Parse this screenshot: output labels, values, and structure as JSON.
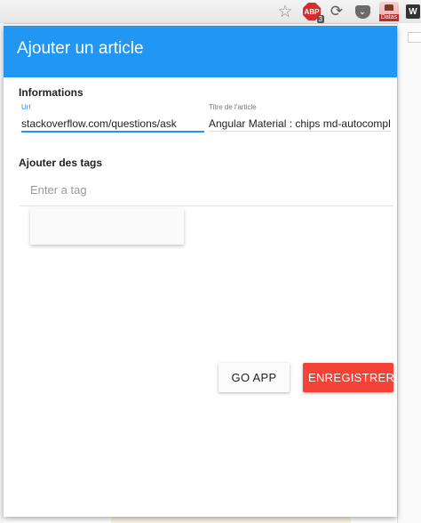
{
  "toolbar": {
    "icons": {
      "star": "star-icon",
      "abp": "adblock-plus-icon",
      "refresh": "refresh-icon",
      "pocket": "pocket-icon",
      "extension": "avatar-extension-icon",
      "w": "w-extension-icon"
    },
    "abp_label": "ABP",
    "abp_badge": "3",
    "ext_label": "Datas",
    "w_label": "W"
  },
  "popup": {
    "title": "Ajouter un article",
    "header_color": "#2196f3",
    "informations": {
      "heading": "Informations",
      "url_label": "Url",
      "url_value": "stackoverflow.com/questions/ask",
      "titre_label": "Titre de l'article",
      "titre_value": "Angular Material : chips md-autocomplete"
    },
    "tags": {
      "heading": "Ajouter des tags",
      "placeholder": "Enter a tag"
    },
    "buttons": {
      "go_app": "GO APP",
      "save": "ENREGISTRER",
      "save_color": "#f44336"
    }
  }
}
